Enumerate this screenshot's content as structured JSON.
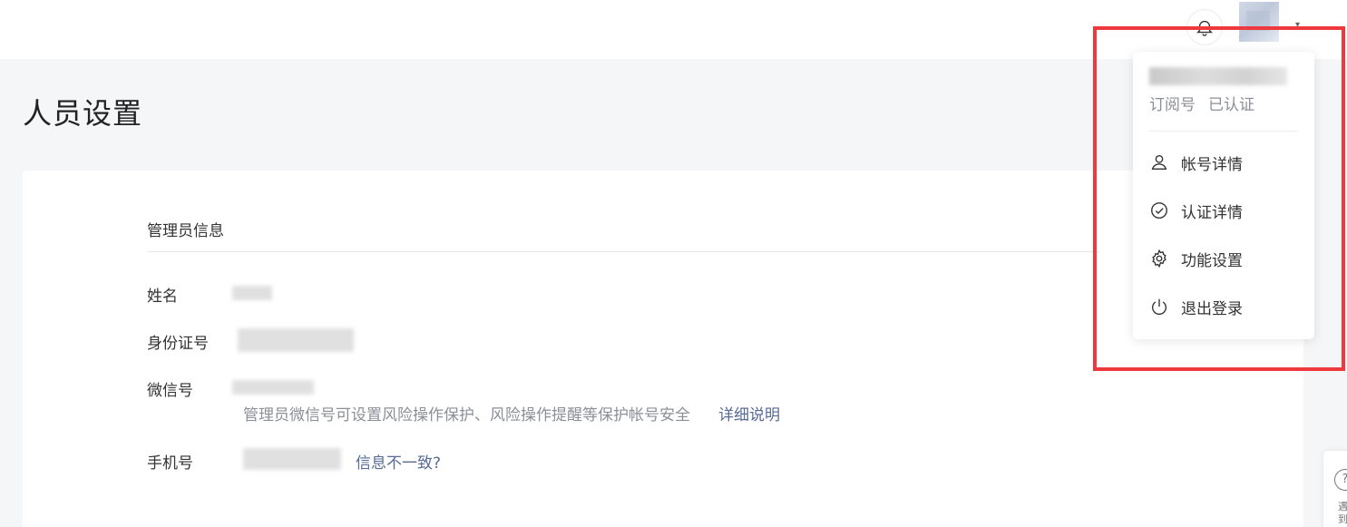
{
  "header": {
    "bell_icon": "bell-icon",
    "avatar_icon": "avatar",
    "caret": "▾"
  },
  "page": {
    "title": "人员设置"
  },
  "admin": {
    "section_title": "管理员信息",
    "name_label": "姓名",
    "id_label": "身份证号",
    "wechat_label": "微信号",
    "wechat_hint": "管理员微信号可设置风险操作保护、风险操作提醒等保护帐号安全",
    "wechat_link": "详细说明",
    "phone_label": "手机号",
    "phone_link": "信息不一致?"
  },
  "dropdown": {
    "account_type": "订阅号",
    "verify_status": "已认证",
    "items": [
      {
        "label": "帐号详情",
        "icon": "user-icon"
      },
      {
        "label": "认证详情",
        "icon": "check-circle-icon"
      },
      {
        "label": "功能设置",
        "icon": "gear-icon"
      },
      {
        "label": "退出登录",
        "icon": "power-icon"
      }
    ]
  },
  "side_widget": {
    "icon": "?",
    "text": "遇到"
  },
  "colors": {
    "highlight": "#ee3a3f",
    "link": "#576b95",
    "muted": "#8b8f97"
  }
}
